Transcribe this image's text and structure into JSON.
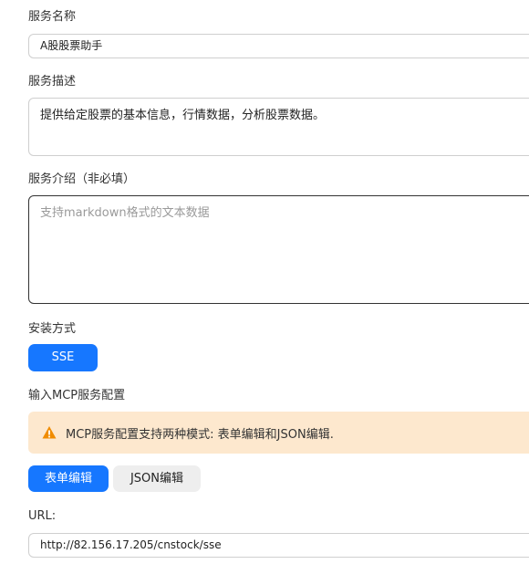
{
  "form": {
    "service_name": {
      "label": "服务名称",
      "value": "A股股票助手"
    },
    "service_description": {
      "label": "服务描述",
      "value": "提供给定股票的基本信息，行情数据，分析股票数据。"
    },
    "service_intro": {
      "label": "服务介绍（非必填）",
      "placeholder": "支持markdown格式的文本数据"
    },
    "install_method": {
      "label": "安装方式",
      "selected": "SSE"
    },
    "mcp_config": {
      "label": "输入MCP服务配置",
      "alert_text": "MCP服务配置支持两种模式: 表单编辑和JSON编辑.",
      "modes": [
        "表单编辑",
        "JSON编辑"
      ],
      "active_mode": "表单编辑"
    },
    "url": {
      "label": "URL:",
      "value": "http://82.156.17.205/cnstock/sse"
    }
  },
  "colors": {
    "primary": "#1677ff",
    "alert_bg": "#fde8ce",
    "warning_icon": "#f08c00"
  }
}
